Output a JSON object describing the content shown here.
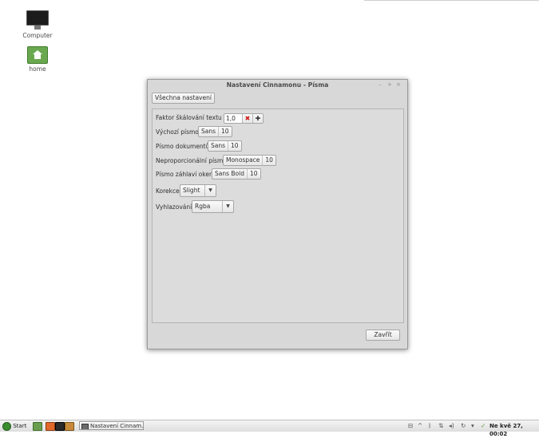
{
  "desktop": {
    "icons": [
      {
        "label": "Computer",
        "icon": "computer-icon"
      },
      {
        "label": "home",
        "icon": "home-folder-icon"
      }
    ]
  },
  "window": {
    "title": "Nastavení Cinnamonu - Písma",
    "controls": [
      "–",
      "+",
      "×"
    ],
    "all_settings_label": "Všechna nastavení",
    "close_label": "Zavřít",
    "rows": {
      "text_scaling": {
        "label": "Faktor škálování textu",
        "value": "1,0"
      },
      "default_font": {
        "label": "Výchozí písmo",
        "font": "Sans",
        "size": "10"
      },
      "document_font": {
        "label": "Písmo dokumentů",
        "font": "Sans",
        "size": "10"
      },
      "monospace_font": {
        "label": "Neproporcionální písmo",
        "font": "Monospace",
        "size": "10"
      },
      "titlebar_font": {
        "label": "Písmo záhlaví oken",
        "font": "Sans Bold",
        "size": "10"
      },
      "hinting": {
        "label": "Korekce",
        "value": "Slight"
      },
      "antialiasing": {
        "label": "Vyhlazování",
        "value": "Rgba"
      }
    }
  },
  "taskbar": {
    "start_label": "Start",
    "window_button_label": "Nastavení Cinnam...",
    "clock": "Ne kvě 27, 00:02"
  }
}
